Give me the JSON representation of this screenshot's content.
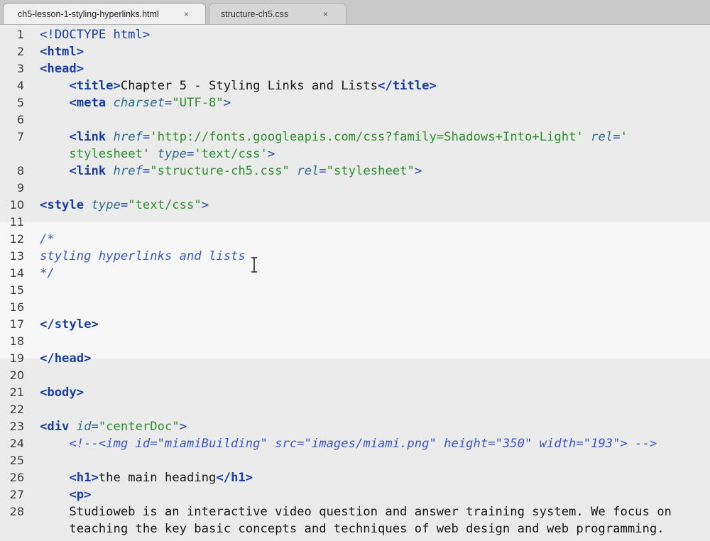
{
  "tabs": [
    {
      "label": "ch5-lesson-1-styling-hyperlinks.html",
      "close": "×",
      "active": true
    },
    {
      "label": "structure-ch5.css",
      "close": "×",
      "active": false
    }
  ],
  "lines": [
    {
      "n": "1",
      "tokens": [
        [
          "pun",
          "<!DOCTYPE html>"
        ]
      ]
    },
    {
      "n": "2",
      "tokens": [
        [
          "tag",
          "<html>"
        ]
      ]
    },
    {
      "n": "3",
      "tokens": [
        [
          "tag",
          "<head>"
        ]
      ]
    },
    {
      "n": "4",
      "tokens": [
        [
          "txt",
          "    "
        ],
        [
          "tag",
          "<title>"
        ],
        [
          "txt",
          "Chapter 5 - Styling Links and Lists"
        ],
        [
          "tag",
          "</title>"
        ]
      ]
    },
    {
      "n": "5",
      "tokens": [
        [
          "txt",
          "    "
        ],
        [
          "tag",
          "<meta"
        ],
        [
          "txt",
          " "
        ],
        [
          "attr",
          "charset"
        ],
        [
          "pun",
          "="
        ],
        [
          "str",
          "\"UTF-8\""
        ],
        [
          "pun",
          ">"
        ]
      ]
    },
    {
      "n": "6",
      "tokens": []
    },
    {
      "n": "7",
      "tokens": [
        [
          "txt",
          "    "
        ],
        [
          "tag",
          "<link"
        ],
        [
          "txt",
          " "
        ],
        [
          "attr",
          "href"
        ],
        [
          "pun",
          "="
        ],
        [
          "str",
          "'http://fonts.googleapis.com/css?family=Shadows+Into+Light'"
        ],
        [
          "txt",
          " "
        ],
        [
          "attr",
          "rel"
        ],
        [
          "pun",
          "="
        ],
        [
          "str",
          "'"
        ]
      ]
    },
    {
      "n": "",
      "tokens": [
        [
          "txt",
          "    "
        ],
        [
          "str",
          "stylesheet'"
        ],
        [
          "txt",
          " "
        ],
        [
          "attr",
          "type"
        ],
        [
          "pun",
          "="
        ],
        [
          "str",
          "'text/css'"
        ],
        [
          "pun",
          ">"
        ]
      ]
    },
    {
      "n": "8",
      "tokens": [
        [
          "txt",
          "    "
        ],
        [
          "tag",
          "<link"
        ],
        [
          "txt",
          " "
        ],
        [
          "attr",
          "href"
        ],
        [
          "pun",
          "="
        ],
        [
          "str",
          "\"structure-ch5.css\""
        ],
        [
          "txt",
          " "
        ],
        [
          "attr",
          "rel"
        ],
        [
          "pun",
          "="
        ],
        [
          "str",
          "\"stylesheet\""
        ],
        [
          "pun",
          ">"
        ]
      ]
    },
    {
      "n": "9",
      "tokens": []
    },
    {
      "n": "10",
      "tokens": [
        [
          "tag",
          "<style"
        ],
        [
          "txt",
          " "
        ],
        [
          "attr",
          "type"
        ],
        [
          "pun",
          "="
        ],
        [
          "str",
          "\"text/css\""
        ],
        [
          "pun",
          ">"
        ]
      ]
    },
    {
      "n": "11",
      "tokens": []
    },
    {
      "n": "12",
      "tokens": [
        [
          "cm",
          "/*"
        ]
      ]
    },
    {
      "n": "13",
      "tokens": [
        [
          "cm",
          "styling hyperlinks and lists"
        ]
      ]
    },
    {
      "n": "14",
      "tokens": [
        [
          "cm",
          "*/"
        ]
      ]
    },
    {
      "n": "15",
      "tokens": []
    },
    {
      "n": "16",
      "tokens": []
    },
    {
      "n": "17",
      "tokens": [
        [
          "tag",
          "</style>"
        ]
      ]
    },
    {
      "n": "18",
      "tokens": []
    },
    {
      "n": "19",
      "tokens": [
        [
          "tag",
          "</head>"
        ]
      ]
    },
    {
      "n": "20",
      "tokens": []
    },
    {
      "n": "21",
      "tokens": [
        [
          "tag",
          "<body>"
        ]
      ]
    },
    {
      "n": "22",
      "tokens": []
    },
    {
      "n": "23",
      "tokens": [
        [
          "tag",
          "<div"
        ],
        [
          "txt",
          " "
        ],
        [
          "attr",
          "id"
        ],
        [
          "pun",
          "="
        ],
        [
          "str",
          "\"centerDoc\""
        ],
        [
          "pun",
          ">"
        ]
      ]
    },
    {
      "n": "24",
      "tokens": [
        [
          "txt",
          "    "
        ],
        [
          "cm",
          "<!--<img id=\"miamiBuilding\" src=\"images/miami.png\" height=\"350\" width=\"193\"> -->"
        ]
      ]
    },
    {
      "n": "25",
      "tokens": []
    },
    {
      "n": "26",
      "tokens": [
        [
          "txt",
          "    "
        ],
        [
          "tag",
          "<h1>"
        ],
        [
          "txt",
          "the main heading"
        ],
        [
          "tag",
          "</h1>"
        ]
      ]
    },
    {
      "n": "27",
      "tokens": [
        [
          "txt",
          "    "
        ],
        [
          "tag",
          "<p>"
        ]
      ]
    },
    {
      "n": "28",
      "tokens": [
        [
          "txt",
          "    Studioweb is an interactive video question and answer training system. We focus on"
        ]
      ]
    },
    {
      "n": "",
      "tokens": [
        [
          "txt",
          "    teaching the key basic concepts and techniques of web design and web programming."
        ]
      ]
    }
  ]
}
